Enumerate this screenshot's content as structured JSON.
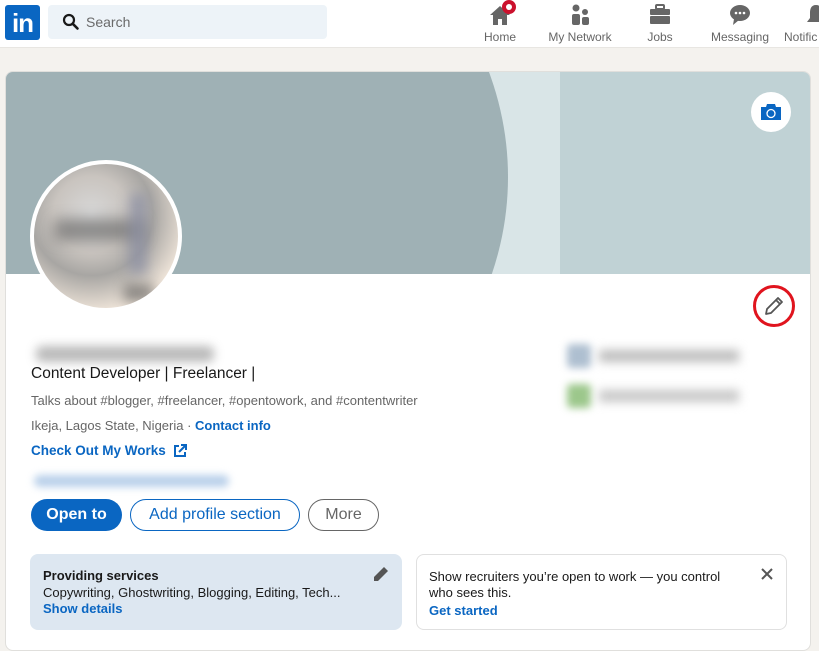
{
  "topbar": {
    "logo_text": "in",
    "search_placeholder": "Search",
    "nav": [
      {
        "label": "Home",
        "icon": "home-icon",
        "has_badge": true
      },
      {
        "label": "My Network",
        "icon": "people-icon"
      },
      {
        "label": "Jobs",
        "icon": "briefcase-icon"
      },
      {
        "label": "Messaging",
        "icon": "chat-icon"
      },
      {
        "label": "Notifications",
        "icon": "bell-icon",
        "visible_label": "Notific"
      }
    ]
  },
  "profile": {
    "name": "(blurred)",
    "headline": "Content Developer | Freelancer |",
    "talks_about": "Talks about #blogger, #freelancer, #opentowork, and #contentwriter",
    "location": "Ikeja, Lagos State, Nigeria · ",
    "contact_info_label": "Contact info",
    "website_label": "Check Out My Works",
    "buttons": {
      "open_to": "Open to",
      "add_section": "Add profile section",
      "more": "More"
    }
  },
  "services": {
    "title": "Providing services",
    "description": "Copywriting, Ghostwriting, Blogging, Editing, Tech...",
    "link": "Show details"
  },
  "recruiters": {
    "message_bold": "Show recruiters you’re open to work",
    "message_rest": " — you control who sees this.",
    "link": "Get started"
  },
  "colors": {
    "brand": "#0a66c2",
    "highlight_ring": "#e0141e",
    "badge": "#cb112d"
  }
}
